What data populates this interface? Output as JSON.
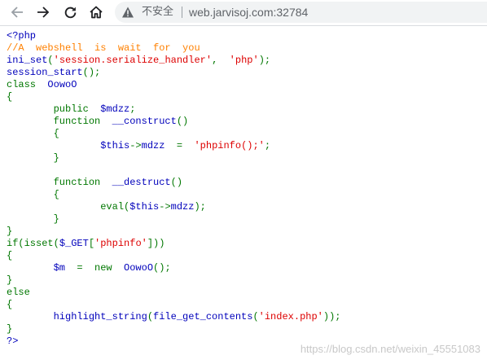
{
  "browser": {
    "security_label": "不安全",
    "url": "web.jarvisoj.com:32784",
    "icons": [
      "back-arrow-icon",
      "forward-arrow-icon",
      "reload-icon",
      "home-icon",
      "warning-triangle-icon"
    ]
  },
  "code_lines": [
    [
      [
        "df",
        "<?php"
      ]
    ],
    [
      [
        "cm",
        "//A  webshell  is  wait  for  you"
      ]
    ],
    [
      [
        "df",
        "ini_set"
      ],
      [
        "kw",
        "("
      ],
      [
        "st",
        "'session.serialize_handler'"
      ],
      [
        "kw",
        ",  "
      ],
      [
        "st",
        "'php'"
      ],
      [
        "kw",
        ");"
      ]
    ],
    [
      [
        "df",
        "session_start"
      ],
      [
        "kw",
        "();"
      ]
    ],
    [
      [
        "kw",
        "class  "
      ],
      [
        "df",
        "OowoO"
      ]
    ],
    [
      [
        "kw",
        "{"
      ]
    ],
    [
      [
        "kw",
        "        public  "
      ],
      [
        "df",
        "$mdzz"
      ],
      [
        "kw",
        ";"
      ]
    ],
    [
      [
        "kw",
        "        function  "
      ],
      [
        "df",
        "__construct"
      ],
      [
        "kw",
        "()"
      ]
    ],
    [
      [
        "kw",
        "        {"
      ]
    ],
    [
      [
        "df",
        "                $this"
      ],
      [
        "kw",
        "->"
      ],
      [
        "df",
        "mdzz  "
      ],
      [
        "kw",
        "=  "
      ],
      [
        "st",
        "'phpinfo();'"
      ],
      [
        "kw",
        ";"
      ]
    ],
    [
      [
        "kw",
        "        }"
      ]
    ],
    [
      [
        "kw",
        ""
      ]
    ],
    [
      [
        "kw",
        "        function  "
      ],
      [
        "df",
        "__destruct"
      ],
      [
        "kw",
        "()"
      ]
    ],
    [
      [
        "kw",
        "        {"
      ]
    ],
    [
      [
        "kw",
        "                eval("
      ],
      [
        "df",
        "$this"
      ],
      [
        "kw",
        "->"
      ],
      [
        "df",
        "mdzz"
      ],
      [
        "kw",
        ");"
      ]
    ],
    [
      [
        "kw",
        "        }"
      ]
    ],
    [
      [
        "kw",
        "}"
      ]
    ],
    [
      [
        "kw",
        "if(isset("
      ],
      [
        "df",
        "$_GET"
      ],
      [
        "kw",
        "["
      ],
      [
        "st",
        "'phpinfo'"
      ],
      [
        "kw",
        "]))"
      ]
    ],
    [
      [
        "kw",
        "{"
      ]
    ],
    [
      [
        "df",
        "        $m  "
      ],
      [
        "kw",
        "=  new  "
      ],
      [
        "df",
        "OowoO"
      ],
      [
        "kw",
        "();"
      ]
    ],
    [
      [
        "kw",
        "}"
      ]
    ],
    [
      [
        "kw",
        "else"
      ]
    ],
    [
      [
        "kw",
        "{"
      ]
    ],
    [
      [
        "df",
        "        highlight_string"
      ],
      [
        "kw",
        "("
      ],
      [
        "df",
        "file_get_contents"
      ],
      [
        "kw",
        "("
      ],
      [
        "st",
        "'index.php'"
      ],
      [
        "kw",
        "));"
      ]
    ],
    [
      [
        "kw",
        "}"
      ]
    ],
    [
      [
        "df",
        "?>"
      ]
    ]
  ],
  "watermark": "https://blog.csdn.net/weixin_45551083",
  "colors": {
    "keyword": "#007700",
    "default": "#0000bb",
    "string": "#dd0000",
    "comment": "#ff8000"
  }
}
